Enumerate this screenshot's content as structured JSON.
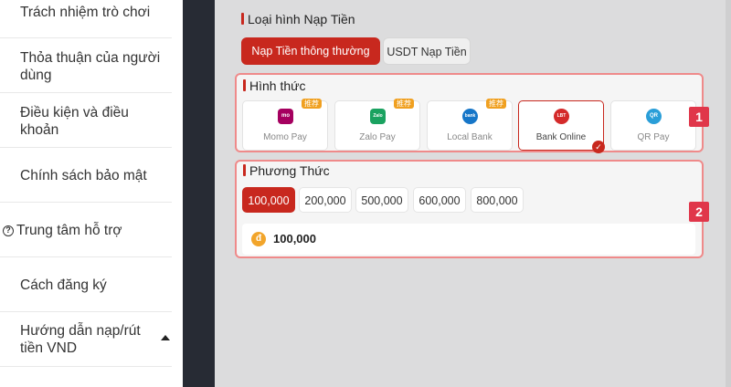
{
  "sidebar": {
    "items": [
      {
        "label": "Trách nhiệm trò chơi"
      },
      {
        "label": "Thỏa thuận của người dùng"
      },
      {
        "label": "Điều kiện và điều khoản"
      },
      {
        "label": "Chính sách bảo mật"
      },
      {
        "label": "Trung tâm hỗ trợ",
        "icon": "help-circle-icon"
      },
      {
        "label": "Cách đăng ký"
      },
      {
        "label": "Hướng dẫn nạp/rút tiền VND",
        "icon": "caret-up-icon"
      }
    ]
  },
  "deposit_type": {
    "title": "Loại hình Nạp Tiền",
    "tabs": [
      {
        "label": "Nạp Tiền thông thường",
        "active": true
      },
      {
        "label": "USDT Nạp Tiền",
        "active": false
      }
    ]
  },
  "method": {
    "title": "Hình thức",
    "step": "1",
    "options": [
      {
        "name": "Momo Pay",
        "logo_text": "mo mo",
        "badge": "推荐",
        "selected": false
      },
      {
        "name": "Zalo Pay",
        "logo_text": "Zalo pay",
        "badge": "推荐",
        "selected": false
      },
      {
        "name": "Local Bank",
        "logo_text": "bank",
        "badge": "推荐",
        "selected": false
      },
      {
        "name": "Bank Online",
        "logo_text": "LBT",
        "badge": "",
        "selected": true
      },
      {
        "name": "QR Pay",
        "logo_text": "QR",
        "badge": "",
        "selected": false
      }
    ]
  },
  "amount": {
    "title": "Phương Thức",
    "step": "2",
    "options": [
      "100,000",
      "200,000",
      "500,000",
      "600,000",
      "800,000"
    ],
    "selected_index": 0,
    "current_value": "100,000",
    "coin_symbol": "đ"
  },
  "colors": {
    "accent": "#c8281e",
    "panel_border": "#ef8a8a",
    "badge": "#f0a020",
    "step_badge": "#e0364a"
  }
}
